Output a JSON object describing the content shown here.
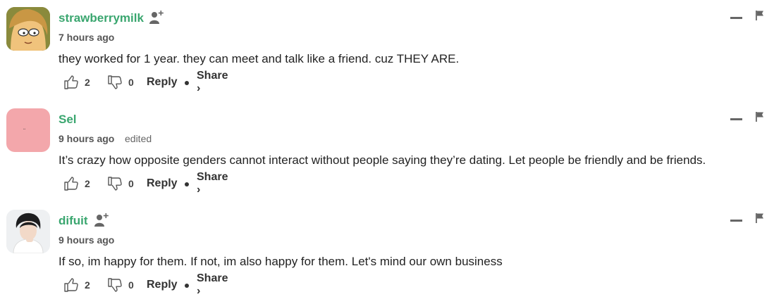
{
  "comments": [
    {
      "username": "strawberrymilk",
      "time": "7 hours ago",
      "edited": "",
      "text": "they worked for 1 year. they can meet and talk like a friend. cuz THEY ARE.",
      "likes": "2",
      "dislikes": "0",
      "reply_label": "Reply",
      "share_label": "Share ›",
      "avatar_style": "cartoon-character"
    },
    {
      "username": "Sel",
      "time": "9 hours ago",
      "edited": "edited",
      "text": "It’s crazy how opposite genders cannot interact without people saying they’re dating. Let people be friendly and be friends.",
      "likes": "2",
      "dislikes": "0",
      "reply_label": "Reply",
      "share_label": "Share ›",
      "avatar_style": "pink-tile"
    },
    {
      "username": "difuit",
      "time": "9 hours ago",
      "edited": "",
      "text": "If so, im happy for them. If not, im also happy for them. Let's mind our own business",
      "likes": "2",
      "dislikes": "0",
      "reply_label": "Reply",
      "share_label": "Share ›",
      "avatar_style": "photo-person"
    }
  ],
  "colors": {
    "username": "#3aa66f",
    "text": "#222222",
    "meta": "#555555",
    "icon": "#666666"
  },
  "icons": [
    "follow-icon",
    "thumbs-up-icon",
    "thumbs-down-icon",
    "collapse-icon",
    "flag-icon"
  ]
}
